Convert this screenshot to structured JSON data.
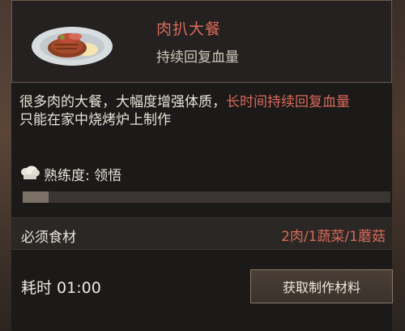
{
  "item": {
    "name": "肉扒大餐",
    "effect": "持续回复血量",
    "description_plain": "很多肉的大餐，大幅度增强体质，",
    "description_highlight": "长时间持续回复血量",
    "description_line2": "只能在家中烧烤炉上制作"
  },
  "proficiency": {
    "label": "熟练度: 领悟",
    "progress": 0.07
  },
  "ingredients": {
    "label": "必须食材",
    "value": "2肉/1蔬菜/1蘑菇"
  },
  "craft_time": {
    "text": "耗时 01:00"
  },
  "actions": {
    "get_materials": "获取制作材料"
  },
  "colors": {
    "highlight": "#d86a5a",
    "text": "#e8e2d8",
    "panel_bg": "#1c1a19"
  },
  "icons": {
    "item_image": "steak-plate-icon",
    "proficiency": "chef-hat-icon"
  }
}
